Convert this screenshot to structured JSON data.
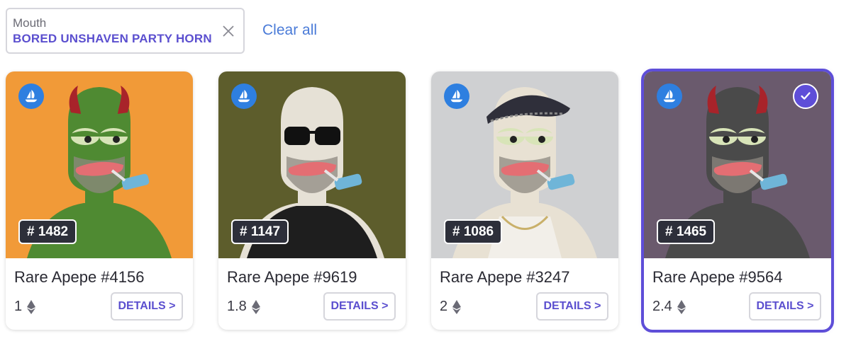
{
  "filter": {
    "label": "Mouth",
    "value": "BORED UNSHAVEN PARTY HORN",
    "clear_all": "Clear all"
  },
  "cards": [
    {
      "rank": "# 1482",
      "title": "Rare Apepe #4156",
      "price": "1",
      "details": "DETAILS >",
      "bg": "#f19a38",
      "skin": "#4f8a32",
      "horns": true,
      "glasses": false,
      "hat": false,
      "shirt": "none",
      "selected": false
    },
    {
      "rank": "# 1147",
      "title": "Rare Apepe #9619",
      "price": "1.8",
      "details": "DETAILS >",
      "bg": "#5d5d2c",
      "skin": "#e6e1d6",
      "horns": false,
      "glasses": true,
      "hat": false,
      "shirt": "black",
      "selected": false
    },
    {
      "rank": "# 1086",
      "title": "Rare Apepe #3247",
      "price": "2",
      "details": "DETAILS >",
      "bg": "#cfd0d2",
      "skin": "#e8e1d3",
      "horns": false,
      "glasses": false,
      "hat": true,
      "shirt": "tank",
      "selected": false
    },
    {
      "rank": "# 1465",
      "title": "Rare Apepe #9564",
      "price": "2.4",
      "details": "DETAILS >",
      "bg": "#6a5a6d",
      "skin": "#4a4a4a",
      "horns": true,
      "glasses": false,
      "hat": false,
      "shirt": "none",
      "selected": true
    }
  ],
  "icons": {
    "marketplace": "opensea-ship-icon",
    "close": "close-icon",
    "selected": "check-icon",
    "currency": "ethereum-icon"
  },
  "colors": {
    "accent": "#5b4fcf",
    "link": "#4a7bd8",
    "selected_border": "#5e4ed8",
    "badge_bg": "#2d2f3a"
  }
}
